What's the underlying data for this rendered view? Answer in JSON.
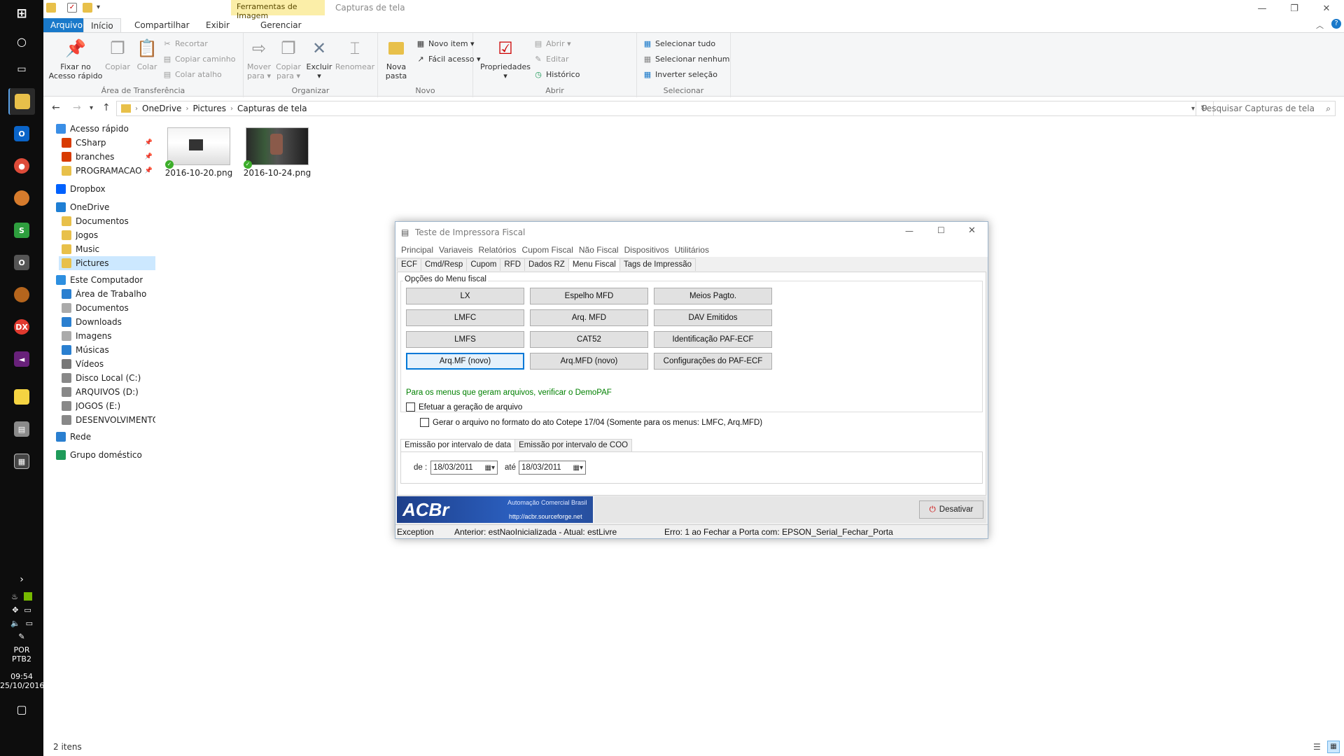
{
  "taskbar": {
    "icons": [
      "windows-icon",
      "cortana-icon",
      "task-view-icon",
      "file-explorer-icon",
      "outlook-icon",
      "chrome-icon",
      "app-icon",
      "s-app-icon",
      "o-app-icon",
      "spartan-icon",
      "devexpress-icon",
      "visual-studio-icon",
      "sticky-notes-icon",
      "printer-icon",
      "calculator-icon"
    ],
    "lang1": "POR",
    "lang2": "PTB2",
    "time": "09:54",
    "date": "25/10/2016"
  },
  "window": {
    "context_tab_group": "Ferramentas de Imagem",
    "title": "Capturas de tela",
    "minimize": "—",
    "maximize": "❐",
    "close": "✕"
  },
  "ribbon_tabs": {
    "file": "Arquivo",
    "home": "Início",
    "share": "Compartilhar",
    "view": "Exibir",
    "manage": "Gerenciar"
  },
  "ribbon": {
    "clipboard": {
      "label": "Área de Transferência",
      "pin_line1": "Fixar no",
      "pin_line2": "Acesso rápido",
      "copy": "Copiar",
      "paste": "Colar",
      "cut": "Recortar",
      "copy_path": "Copiar caminho",
      "paste_shortcut": "Colar atalho"
    },
    "organize": {
      "label": "Organizar",
      "move_line1": "Mover",
      "move_line2": "para ▾",
      "copyto_line1": "Copiar",
      "copyto_line2": "para ▾",
      "delete": "Excluir",
      "delete_arrow": "▾",
      "rename": "Renomear"
    },
    "new": {
      "label": "Novo",
      "folder_line1": "Nova",
      "folder_line2": "pasta",
      "new_item": "Novo item ▾",
      "easy_access": "Fácil acesso ▾"
    },
    "open": {
      "label": "Abrir",
      "props": "Propriedades",
      "props_arrow": "▾",
      "open": "Abrir ▾",
      "edit": "Editar",
      "history": "Histórico"
    },
    "select": {
      "label": "Selecionar",
      "all": "Selecionar tudo",
      "none": "Selecionar nenhum",
      "invert": "Inverter seleção"
    }
  },
  "address": {
    "crumbs": [
      "OneDrive",
      "Pictures",
      "Capturas de tela"
    ],
    "search_placeholder": "Pesquisar Capturas de tela"
  },
  "nav": [
    {
      "label": "Acesso rápido",
      "indent": 0,
      "color": "#3a8ee6",
      "pin": ""
    },
    {
      "label": "CSharp",
      "indent": 1,
      "color": "#d83b01",
      "pin": "📌"
    },
    {
      "label": "branches",
      "indent": 1,
      "color": "#d83b01",
      "pin": "📌"
    },
    {
      "label": "PROGRAMACAO",
      "indent": 1,
      "color": "#e8c04a",
      "pin": "📌"
    },
    {
      "label": "Dropbox",
      "indent": 0,
      "color": "#0061fe",
      "pin": ""
    },
    {
      "label": "OneDrive",
      "indent": 0,
      "color": "#1f7fd4",
      "pin": ""
    },
    {
      "label": "Documentos",
      "indent": 1,
      "color": "#e8c04a",
      "pin": ""
    },
    {
      "label": "Jogos",
      "indent": 1,
      "color": "#e8c04a",
      "pin": ""
    },
    {
      "label": "Music",
      "indent": 1,
      "color": "#e8c04a",
      "pin": ""
    },
    {
      "label": "Pictures",
      "indent": 1,
      "color": "#e8c04a",
      "pin": ""
    },
    {
      "label": "Este Computador",
      "indent": 0,
      "color": "#2d8fe0",
      "pin": ""
    },
    {
      "label": "Área de Trabalho",
      "indent": 1,
      "color": "#2a7fd0",
      "pin": ""
    },
    {
      "label": "Documentos",
      "indent": 1,
      "color": "#aaaaaa",
      "pin": ""
    },
    {
      "label": "Downloads",
      "indent": 1,
      "color": "#2a7fd0",
      "pin": ""
    },
    {
      "label": "Imagens",
      "indent": 1,
      "color": "#aaaaaa",
      "pin": ""
    },
    {
      "label": "Músicas",
      "indent": 1,
      "color": "#2a7fd0",
      "pin": ""
    },
    {
      "label": "Vídeos",
      "indent": 1,
      "color": "#777777",
      "pin": ""
    },
    {
      "label": "Disco Local (C:)",
      "indent": 1,
      "color": "#888888",
      "pin": ""
    },
    {
      "label": "ARQUIVOS (D:)",
      "indent": 1,
      "color": "#888888",
      "pin": ""
    },
    {
      "label": "JOGOS (E:)",
      "indent": 1,
      "color": "#888888",
      "pin": ""
    },
    {
      "label": "DESENVOLVIMENTO",
      "indent": 1,
      "color": "#888888",
      "pin": ""
    },
    {
      "label": "Rede",
      "indent": 0,
      "color": "#2a7fd0",
      "pin": ""
    },
    {
      "label": "Grupo doméstico",
      "indent": 0,
      "color": "#1f9b5a",
      "pin": ""
    }
  ],
  "files": [
    {
      "name": "2016-10-20.png"
    },
    {
      "name": "2016-10-24.png"
    }
  ],
  "status": {
    "count": "2 itens"
  },
  "dialog": {
    "title": "Teste de Impressora Fiscal",
    "menu": [
      "Principal",
      "Variaveis",
      "Relatórios",
      "Cupom Fiscal",
      "Não Fiscal",
      "Dispositivos",
      "Utilitários"
    ],
    "tabs": [
      "ECF",
      "Cmd/Resp",
      "Cupom",
      "RFD",
      "Dados RZ",
      "Menu Fiscal",
      "Tags de Impressão"
    ],
    "group_label": "Opções do Menu fiscal",
    "buttons": [
      "LX",
      "Espelho MFD",
      "Meios Pagto.",
      "LMFC",
      "Arq. MFD",
      "DAV Emitidos",
      "LMFS",
      "CAT52",
      "Identificação PAF-ECF",
      "Arq.MF (novo)",
      "Arq.MFD (novo)",
      "Configurações do PAF-ECF"
    ],
    "note": "Para os menus que geram arquivos, verificar o DemoPAF",
    "note_color": "#008000",
    "chk1": "Efetuar a geração de arquivo",
    "chk2": "Gerar o arquivo no formato do ato Cotepe 17/04 (Somente para os menus: LMFC, Arq.MFD)",
    "sub_tabs": [
      "Emissão por intervalo de data",
      "Emissão por intervalo de COO"
    ],
    "from_label": "de :",
    "to_label": "até",
    "from_date": "18/03/2011",
    "to_date": "18/03/2011",
    "banner_logo": "ACBr",
    "banner_text1": "Automação Comercial Brasil",
    "banner_text2": "http://acbr.sourceforge.net",
    "deactivate": "Desativar",
    "status_a": "Exception",
    "status_b": "Anterior: estNaoInicializada - Atual: estLivre",
    "status_c": "Erro: 1 ao Fechar a Porta com:  EPSON_Serial_Fechar_Porta"
  }
}
